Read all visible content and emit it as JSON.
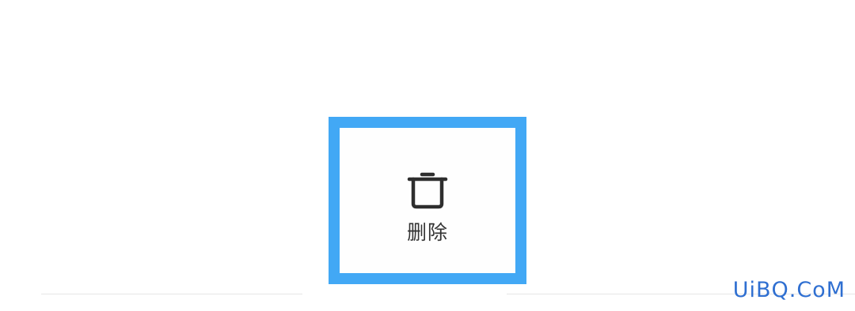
{
  "action": {
    "label": "删除",
    "icon": "trash-icon"
  },
  "highlight": {
    "color": "#42a8f5"
  },
  "watermark": {
    "text": "UiBQ.CoM",
    "color": "#2f6fd1"
  }
}
